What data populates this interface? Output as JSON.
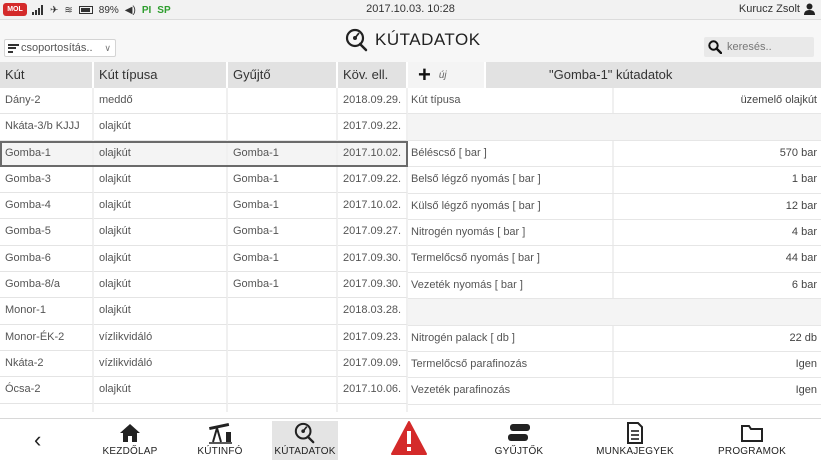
{
  "status_bar": {
    "logo": "MOL",
    "battery_text": "89%",
    "flags": [
      "PI",
      "SP"
    ],
    "datetime": "2017.10.03. 10:28",
    "user": "Kurucz Zsolt"
  },
  "header": {
    "group_select": "csoportosítás..",
    "title": "KÚTADATOK",
    "search_placeholder": "keresés.."
  },
  "wells_table": {
    "columns": [
      "Kút",
      "Kút típusa",
      "Gyűjtő",
      "Köv. ell."
    ],
    "rows": [
      [
        "Dány-2",
        "meddő",
        "",
        "2018.09.29."
      ],
      [
        "Nkáta-3/b KJJJ",
        "olajkút",
        "",
        "2017.09.22."
      ],
      [
        "Gomba-1",
        "olajkút",
        "Gomba-1",
        "2017.10.02."
      ],
      [
        "Gomba-3",
        "olajkút",
        "Gomba-1",
        "2017.09.22."
      ],
      [
        "Gomba-4",
        "olajkút",
        "Gomba-1",
        "2017.10.02."
      ],
      [
        "Gomba-5",
        "olajkút",
        "Gomba-1",
        "2017.09.27."
      ],
      [
        "Gomba-6",
        "olajkút",
        "Gomba-1",
        "2017.09.30."
      ],
      [
        "Gomba-8/a",
        "olajkút",
        "Gomba-1",
        "2017.09.30."
      ],
      [
        "Monor-1",
        "olajkút",
        "",
        "2018.03.28."
      ],
      [
        "Monor-ÉK-2",
        "vízlikvidáló",
        "",
        "2017.09.23."
      ],
      [
        "Nkáta-2",
        "vízlikvidáló",
        "",
        "2017.09.09."
      ],
      [
        "Ócsa-2",
        "olajkút",
        "",
        "2017.10.06."
      ],
      [
        "",
        "",
        "",
        ""
      ]
    ],
    "selected_index": 2
  },
  "detail": {
    "add_label": "új",
    "title": "\"Gomba-1\" kútadatok",
    "rows": [
      {
        "label": "Kút típusa",
        "value": "üzemelő olajkút"
      },
      {
        "label": "",
        "value": ""
      },
      {
        "label": "Béléscső [ bar ]",
        "value": "570 bar"
      },
      {
        "label": "Belső légző nyomás [ bar ]",
        "value": "1 bar"
      },
      {
        "label": "Külső légző nyomás [ bar ]",
        "value": "12 bar"
      },
      {
        "label": "Nitrogén nyomás [ bar ]",
        "value": "4 bar"
      },
      {
        "label": "Termelőcső nyomás [ bar ]",
        "value": "44 bar"
      },
      {
        "label": "Vezeték nyomás [ bar ]",
        "value": "6 bar"
      },
      {
        "label": "",
        "value": ""
      },
      {
        "label": "Nitrogén palack [ db ]",
        "value": "22 db"
      },
      {
        "label": "Termelőcső parafinozás",
        "value": "Igen"
      },
      {
        "label": "Vezeték parafinozás",
        "value": "Igen"
      }
    ]
  },
  "bottom_nav": {
    "items": [
      {
        "label": "KEZDŐLAP",
        "icon": "home-icon"
      },
      {
        "label": "KÚTINFÓ",
        "icon": "pumpjack-icon"
      },
      {
        "label": "KÚTADATOK",
        "icon": "gauge-icon"
      },
      {
        "label": "",
        "icon": "warning-icon"
      },
      {
        "label": "GYŰJTŐK",
        "icon": "collector-icon"
      },
      {
        "label": "MUNKAJEGYEK",
        "icon": "document-icon"
      },
      {
        "label": "PROGRAMOK",
        "icon": "folder-icon"
      }
    ],
    "active_index": 2
  },
  "colors": {
    "warning": "#d42a2a",
    "header_bg": "#e2e2e2",
    "selected_outline": "#6a6a6a"
  }
}
